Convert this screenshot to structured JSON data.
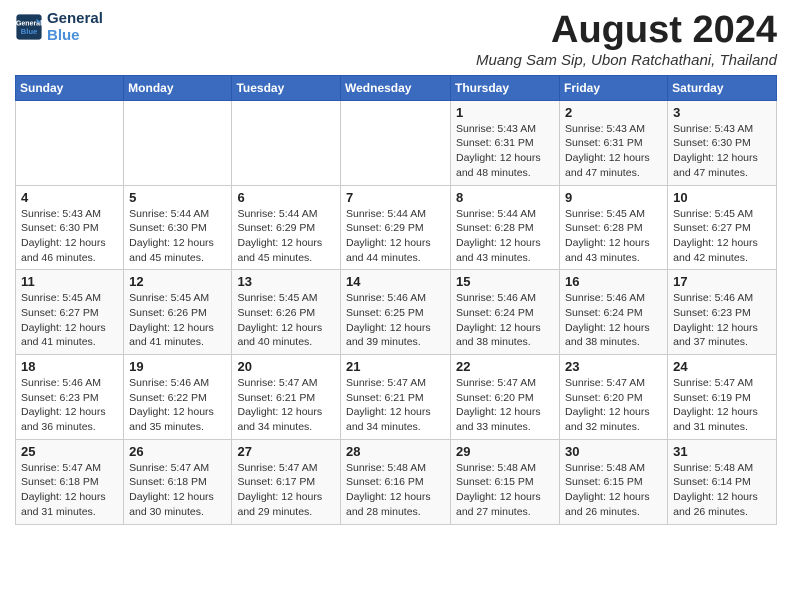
{
  "logo": {
    "line1": "General",
    "line2": "Blue"
  },
  "header": {
    "month_year": "August 2024",
    "location": "Muang Sam Sip, Ubon Ratchathani, Thailand"
  },
  "days_of_week": [
    "Sunday",
    "Monday",
    "Tuesday",
    "Wednesday",
    "Thursday",
    "Friday",
    "Saturday"
  ],
  "weeks": [
    [
      {
        "day": "",
        "info": ""
      },
      {
        "day": "",
        "info": ""
      },
      {
        "day": "",
        "info": ""
      },
      {
        "day": "",
        "info": ""
      },
      {
        "day": "1",
        "info": "Sunrise: 5:43 AM\nSunset: 6:31 PM\nDaylight: 12 hours\nand 48 minutes."
      },
      {
        "day": "2",
        "info": "Sunrise: 5:43 AM\nSunset: 6:31 PM\nDaylight: 12 hours\nand 47 minutes."
      },
      {
        "day": "3",
        "info": "Sunrise: 5:43 AM\nSunset: 6:30 PM\nDaylight: 12 hours\nand 47 minutes."
      }
    ],
    [
      {
        "day": "4",
        "info": "Sunrise: 5:43 AM\nSunset: 6:30 PM\nDaylight: 12 hours\nand 46 minutes."
      },
      {
        "day": "5",
        "info": "Sunrise: 5:44 AM\nSunset: 6:30 PM\nDaylight: 12 hours\nand 45 minutes."
      },
      {
        "day": "6",
        "info": "Sunrise: 5:44 AM\nSunset: 6:29 PM\nDaylight: 12 hours\nand 45 minutes."
      },
      {
        "day": "7",
        "info": "Sunrise: 5:44 AM\nSunset: 6:29 PM\nDaylight: 12 hours\nand 44 minutes."
      },
      {
        "day": "8",
        "info": "Sunrise: 5:44 AM\nSunset: 6:28 PM\nDaylight: 12 hours\nand 43 minutes."
      },
      {
        "day": "9",
        "info": "Sunrise: 5:45 AM\nSunset: 6:28 PM\nDaylight: 12 hours\nand 43 minutes."
      },
      {
        "day": "10",
        "info": "Sunrise: 5:45 AM\nSunset: 6:27 PM\nDaylight: 12 hours\nand 42 minutes."
      }
    ],
    [
      {
        "day": "11",
        "info": "Sunrise: 5:45 AM\nSunset: 6:27 PM\nDaylight: 12 hours\nand 41 minutes."
      },
      {
        "day": "12",
        "info": "Sunrise: 5:45 AM\nSunset: 6:26 PM\nDaylight: 12 hours\nand 41 minutes."
      },
      {
        "day": "13",
        "info": "Sunrise: 5:45 AM\nSunset: 6:26 PM\nDaylight: 12 hours\nand 40 minutes."
      },
      {
        "day": "14",
        "info": "Sunrise: 5:46 AM\nSunset: 6:25 PM\nDaylight: 12 hours\nand 39 minutes."
      },
      {
        "day": "15",
        "info": "Sunrise: 5:46 AM\nSunset: 6:24 PM\nDaylight: 12 hours\nand 38 minutes."
      },
      {
        "day": "16",
        "info": "Sunrise: 5:46 AM\nSunset: 6:24 PM\nDaylight: 12 hours\nand 38 minutes."
      },
      {
        "day": "17",
        "info": "Sunrise: 5:46 AM\nSunset: 6:23 PM\nDaylight: 12 hours\nand 37 minutes."
      }
    ],
    [
      {
        "day": "18",
        "info": "Sunrise: 5:46 AM\nSunset: 6:23 PM\nDaylight: 12 hours\nand 36 minutes."
      },
      {
        "day": "19",
        "info": "Sunrise: 5:46 AM\nSunset: 6:22 PM\nDaylight: 12 hours\nand 35 minutes."
      },
      {
        "day": "20",
        "info": "Sunrise: 5:47 AM\nSunset: 6:21 PM\nDaylight: 12 hours\nand 34 minutes."
      },
      {
        "day": "21",
        "info": "Sunrise: 5:47 AM\nSunset: 6:21 PM\nDaylight: 12 hours\nand 34 minutes."
      },
      {
        "day": "22",
        "info": "Sunrise: 5:47 AM\nSunset: 6:20 PM\nDaylight: 12 hours\nand 33 minutes."
      },
      {
        "day": "23",
        "info": "Sunrise: 5:47 AM\nSunset: 6:20 PM\nDaylight: 12 hours\nand 32 minutes."
      },
      {
        "day": "24",
        "info": "Sunrise: 5:47 AM\nSunset: 6:19 PM\nDaylight: 12 hours\nand 31 minutes."
      }
    ],
    [
      {
        "day": "25",
        "info": "Sunrise: 5:47 AM\nSunset: 6:18 PM\nDaylight: 12 hours\nand 31 minutes."
      },
      {
        "day": "26",
        "info": "Sunrise: 5:47 AM\nSunset: 6:18 PM\nDaylight: 12 hours\nand 30 minutes."
      },
      {
        "day": "27",
        "info": "Sunrise: 5:47 AM\nSunset: 6:17 PM\nDaylight: 12 hours\nand 29 minutes."
      },
      {
        "day": "28",
        "info": "Sunrise: 5:48 AM\nSunset: 6:16 PM\nDaylight: 12 hours\nand 28 minutes."
      },
      {
        "day": "29",
        "info": "Sunrise: 5:48 AM\nSunset: 6:15 PM\nDaylight: 12 hours\nand 27 minutes."
      },
      {
        "day": "30",
        "info": "Sunrise: 5:48 AM\nSunset: 6:15 PM\nDaylight: 12 hours\nand 26 minutes."
      },
      {
        "day": "31",
        "info": "Sunrise: 5:48 AM\nSunset: 6:14 PM\nDaylight: 12 hours\nand 26 minutes."
      }
    ]
  ]
}
